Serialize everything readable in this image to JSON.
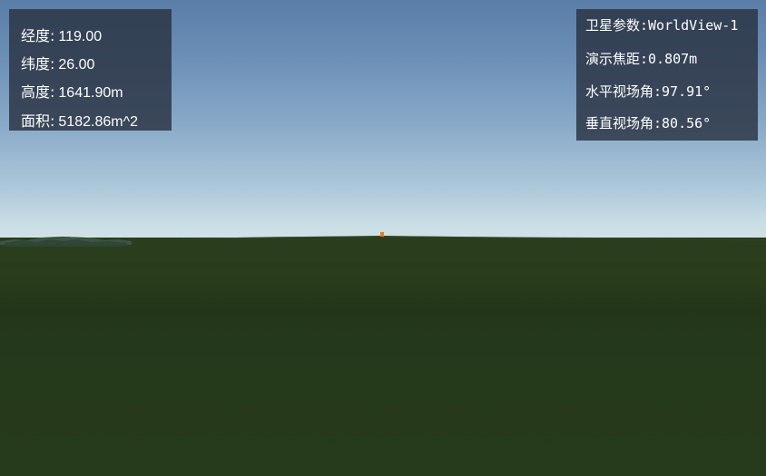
{
  "info_panel": {
    "rows": [
      {
        "label": "经度:",
        "value": "119.00"
      },
      {
        "label": "纬度:",
        "value": "26.00"
      },
      {
        "label": "高度:",
        "value": "1641.90m"
      },
      {
        "label": "面积:",
        "value": "5182.86m^2"
      }
    ]
  },
  "satellite_panel": {
    "rows": [
      {
        "text": "卫星参数:WorldView-1"
      },
      {
        "text": "演示焦距:0.807m"
      },
      {
        "text": "水平视场角:97.91°"
      },
      {
        "text": "垂直视场角:80.56°"
      }
    ]
  },
  "scene": {
    "marker_color": "#f07a1a",
    "sky_color_top": "#5a7ea8",
    "ground_color": "#263b1b"
  }
}
